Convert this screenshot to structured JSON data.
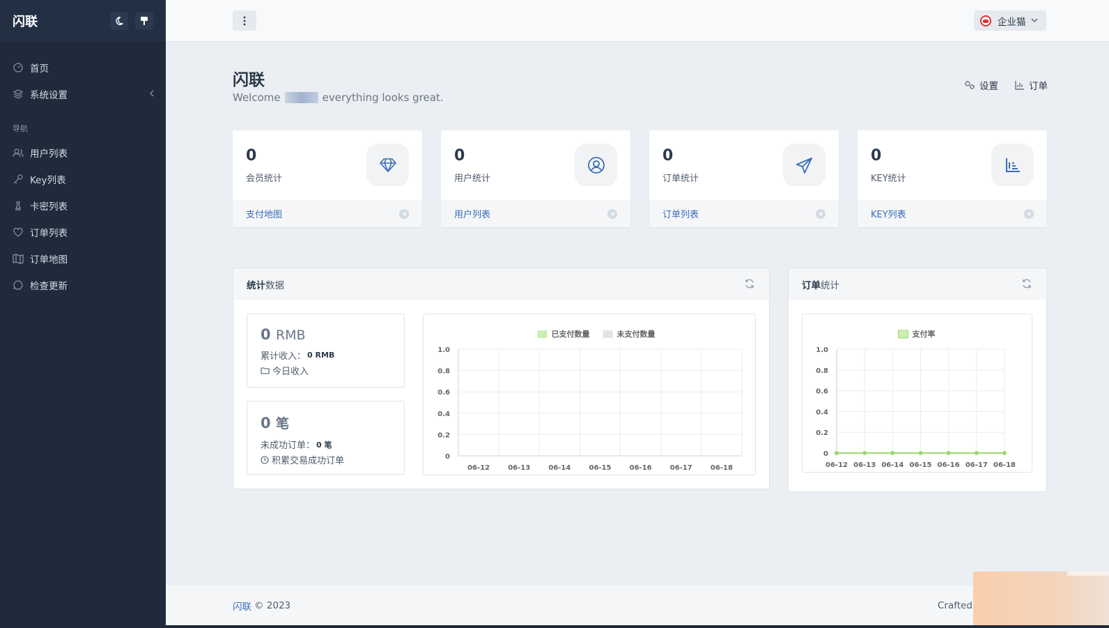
{
  "app": {
    "title": "闪联"
  },
  "sidebar": {
    "items": [
      {
        "label": "首页",
        "icon": "dashboard-icon"
      },
      {
        "label": "系统设置",
        "icon": "layers-icon"
      }
    ],
    "nav_heading": "导航",
    "nav_items": [
      {
        "label": "用户列表",
        "icon": "users-icon"
      },
      {
        "label": "Key列表",
        "icon": "key-icon"
      },
      {
        "label": "卡密列表",
        "icon": "chess-icon"
      },
      {
        "label": "订单列表",
        "icon": "heart-icon"
      },
      {
        "label": "订单地图",
        "icon": "map-icon"
      },
      {
        "label": "检查更新",
        "icon": "chat-icon"
      }
    ]
  },
  "header": {
    "user_name": "企业猫"
  },
  "page": {
    "title": "闪联",
    "welcome_prefix": "Welcome",
    "welcome_suffix": "everything looks great.",
    "links": [
      {
        "label": "设置"
      },
      {
        "label": "订单"
      }
    ]
  },
  "stats": [
    {
      "value": "0",
      "label": "会员统计",
      "link": "支付地图",
      "icon": "diamond-icon"
    },
    {
      "value": "0",
      "label": "用户统计",
      "link": "用户列表",
      "icon": "user-circle-icon"
    },
    {
      "value": "0",
      "label": "订单统计",
      "link": "订单列表",
      "icon": "send-icon"
    },
    {
      "value": "0",
      "label": "KEY统计",
      "link": "KEY列表",
      "icon": "bar-chart-icon"
    }
  ],
  "stats_panel": {
    "title_bold": "统计",
    "title_rest": "数据",
    "revenue": {
      "value": "0",
      "unit": "RMB",
      "total_label": "累计收入：",
      "total_value": "0 RMB",
      "today_label": "今日收入"
    },
    "orders": {
      "value": "0",
      "unit": "笔",
      "failed_label": "未成功订单：",
      "failed_value": "0 笔",
      "success_label": "积累交易成功订单"
    }
  },
  "orders_panel": {
    "title_bold": "订单",
    "title_rest": "统计"
  },
  "footer": {
    "brand": "闪联",
    "copyright": "© 2023",
    "crafted": "Crafted"
  },
  "colors": {
    "sidebar_bg": "#1f2a3a",
    "accent": "#3a6cb8",
    "paid_green": "#cdeeb0",
    "unpaid_gray": "#e2e4e7",
    "rate_green": "#9bd86e"
  },
  "chart_data": [
    {
      "type": "bar",
      "categories": [
        "06-12",
        "06-13",
        "06-14",
        "06-15",
        "06-16",
        "06-17",
        "06-18"
      ],
      "series": [
        {
          "name": "已支付数量",
          "values": [
            0,
            0,
            0,
            0,
            0,
            0,
            0
          ]
        },
        {
          "name": "未支付数量",
          "values": [
            0,
            0,
            0,
            0,
            0,
            0,
            0
          ]
        }
      ],
      "y_ticks": [
        "0",
        "0.2",
        "0.4",
        "0.6",
        "0.8",
        "1.0"
      ],
      "ylim": [
        0,
        1
      ],
      "legend": "top-center",
      "grid": true
    },
    {
      "type": "line",
      "categories": [
        "06-12",
        "06-13",
        "06-14",
        "06-15",
        "06-16",
        "06-17",
        "06-18"
      ],
      "series": [
        {
          "name": "支付率",
          "values": [
            0,
            0,
            0,
            0,
            0,
            0,
            0
          ]
        }
      ],
      "y_ticks": [
        "0",
        "0.2",
        "0.4",
        "0.6",
        "0.8",
        "1.0"
      ],
      "ylim": [
        0,
        1
      ],
      "legend": "top-center",
      "grid": true
    }
  ]
}
